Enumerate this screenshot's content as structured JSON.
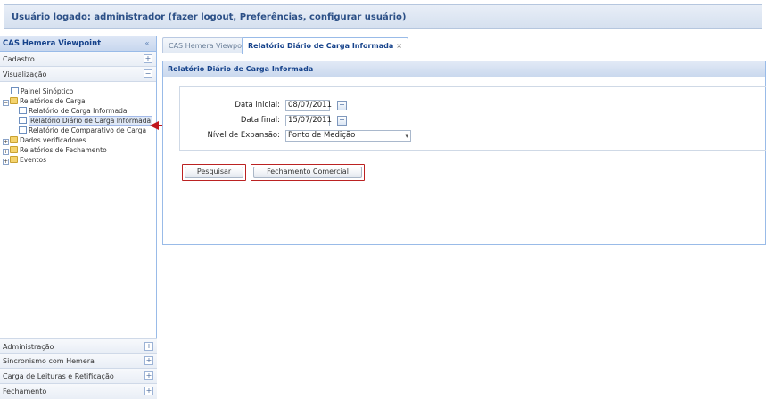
{
  "header": {
    "user_text": "Usuário logado: administrador (fazer logout, Preferências, configurar usuário)"
  },
  "sidebar": {
    "title": "CAS Hemera Viewpoint",
    "collapse_glyph": "«",
    "sections_top": [
      {
        "label": "Cadastro",
        "tool": "+"
      },
      {
        "label": "Visualização",
        "tool": "−"
      }
    ],
    "tree": [
      {
        "label": "Painel Sinóptico"
      },
      {
        "label": "Relatórios de Carga",
        "toggle": "−"
      },
      {
        "label": "Relatório de Carga Informada"
      },
      {
        "label": "Relatório Diário de Carga Informada"
      },
      {
        "label": "Relatório de Comparativo de Carga"
      },
      {
        "label": "Dados verificadores",
        "toggle": "+"
      },
      {
        "label": "Relatórios de Fechamento",
        "toggle": "+"
      },
      {
        "label": "Eventos",
        "toggle": "+"
      }
    ],
    "sections_bottom": [
      {
        "label": "Administração",
        "tool": "+"
      },
      {
        "label": "Sincronismo com Hemera",
        "tool": "+"
      },
      {
        "label": "Carga de Leituras e Retificação",
        "tool": "+"
      },
      {
        "label": "Fechamento",
        "tool": "+"
      }
    ]
  },
  "tabs": [
    {
      "label": "CAS Hemera Viewpoint"
    },
    {
      "label": "Relatório Diário de Carga Informada",
      "close": "×"
    }
  ],
  "panel": {
    "title": "Relatório Diário de Carga Informada",
    "fields": {
      "data_inicial_label": "Data inicial:",
      "data_inicial_value": "08/07/2011",
      "data_final_label": "Data final:",
      "data_final_value": "15/07/2011",
      "nivel_label": "Nível de Expansão:",
      "nivel_value": "Ponto de Medição",
      "dropdown_glyph": "▾"
    },
    "buttons": {
      "pesquisar": "Pesquisar",
      "fechamento": "Fechamento Comercial"
    }
  },
  "colors": {
    "accent": "#15428b",
    "highlight": "#b22222"
  }
}
